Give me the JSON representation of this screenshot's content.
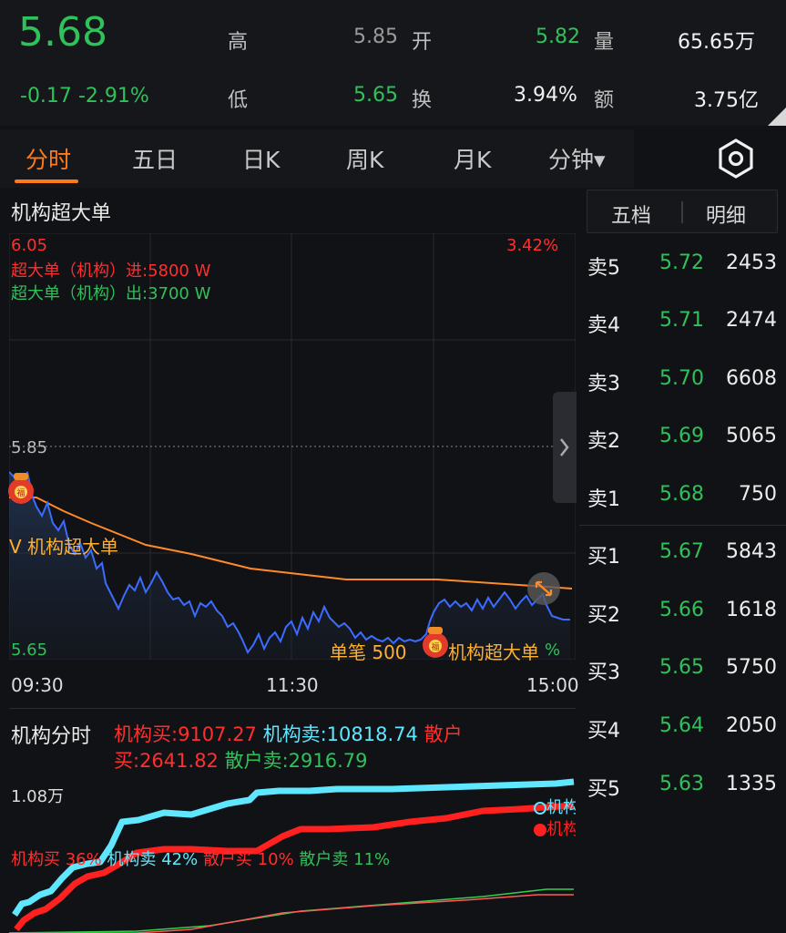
{
  "quote": {
    "price": "5.68",
    "change": "-0.17",
    "change_pct": "-2.91%",
    "high_label": "高",
    "high_val": "5.85",
    "open_label": "开",
    "open_val": "5.82",
    "vol_label": "量",
    "vol_val": "65.65万",
    "low_label": "低",
    "low_val": "5.65",
    "turnover_label": "换",
    "turnover_val": "3.94%",
    "amount_label": "额",
    "amount_val": "3.75亿"
  },
  "tabs": [
    {
      "label": "分时",
      "active": true
    },
    {
      "label": "五日"
    },
    {
      "label": "日K"
    },
    {
      "label": "周K"
    },
    {
      "label": "月K"
    },
    {
      "label": "分钟▾"
    }
  ],
  "settings_icon": "settings-hex-icon",
  "intraday": {
    "title": "机构超大单",
    "top_price": "6.05",
    "top_pct": "3.42%",
    "mid_price": "5.85",
    "bottom_price": "5.65",
    "bottom_pct": "%",
    "inst_in": "超大单（机构）进:5800 W",
    "inst_out": "超大单（机构）出:3700 W",
    "marker_left": "V 机构超大单",
    "marker_right_a": "单笔 500",
    "marker_right_b": "机构超大单",
    "time_start": "09:30",
    "time_mid": "11:30",
    "time_end": "15:00",
    "colors": {
      "price_line": "#3c6cff",
      "avg_line": "#ff8a2a",
      "up": "#ff2f2f",
      "down": "#2fc15a"
    }
  },
  "order_book": {
    "tabs": [
      "五档",
      "明细"
    ],
    "asks": [
      {
        "label": "卖5",
        "price": "5.72",
        "vol": "2453"
      },
      {
        "label": "卖4",
        "price": "5.71",
        "vol": "2474"
      },
      {
        "label": "卖3",
        "price": "5.70",
        "vol": "6608"
      },
      {
        "label": "卖2",
        "price": "5.69",
        "vol": "5065"
      },
      {
        "label": "卖1",
        "price": "5.68",
        "vol": "750"
      }
    ],
    "bids": [
      {
        "label": "买1",
        "price": "5.67",
        "vol": "5843"
      },
      {
        "label": "买2",
        "price": "5.66",
        "vol": "1618"
      },
      {
        "label": "买3",
        "price": "5.65",
        "vol": "5750"
      },
      {
        "label": "买4",
        "price": "5.64",
        "vol": "2050"
      },
      {
        "label": "买5",
        "price": "5.63",
        "vol": "1335"
      }
    ]
  },
  "institution": {
    "title": "机构分时",
    "inst_buy": "机构买:9107.27",
    "inst_sell": "机构卖:10818.74",
    "retail_label": "散户",
    "retail_buy": "买:2641.82",
    "retail_sell": "散户卖:2916.79",
    "axis_top": "1.08万",
    "pct_inst_buy": "机构买 36%",
    "pct_inst_sell": "机构卖 42%",
    "pct_retail_buy": "散户买 10%",
    "pct_retail_sell": "散户卖 11%",
    "legend_a": "机构",
    "legend_b": "机构",
    "colors": {
      "inst_sell": "#5fe7ff",
      "inst_buy": "#ff2020",
      "retail_buy": "#ff5a5a",
      "retail_sell": "#35d04a"
    }
  }
}
